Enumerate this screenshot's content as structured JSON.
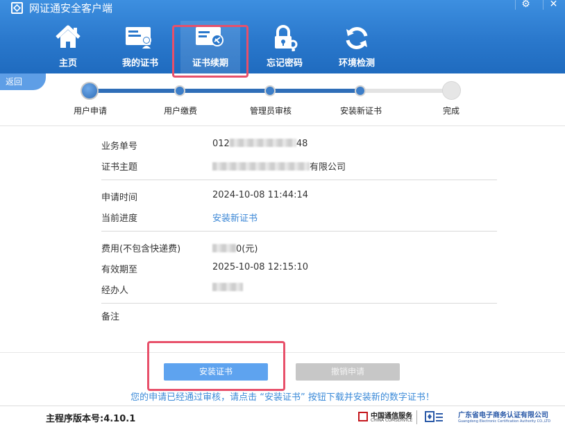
{
  "window": {
    "title": "网证通安全客户端",
    "settings_glyph": "⚙",
    "close_glyph": "✕"
  },
  "nav": {
    "items": [
      {
        "label": "主页",
        "icon": "home-icon"
      },
      {
        "label": "我的证书",
        "icon": "certificate-card-icon"
      },
      {
        "label": "证书续期",
        "icon": "certificate-renew-icon",
        "active": true
      },
      {
        "label": "忘记密码",
        "icon": "lock-key-icon"
      },
      {
        "label": "环境检测",
        "icon": "refresh-icon"
      }
    ]
  },
  "back_label": "返回",
  "steps": {
    "items": [
      "用户申请",
      "用户缴费",
      "管理员审核",
      "安装新证书",
      "完成"
    ],
    "completed_count": 4
  },
  "details": {
    "order_no": {
      "label": "业务单号",
      "prefix": "012",
      "suffix": "48"
    },
    "subject": {
      "label": "证书主题",
      "suffix": "有限公司"
    },
    "apply_time": {
      "label": "申请时间",
      "value": "2024-10-08 11:44:14"
    },
    "progress": {
      "label": "当前进度",
      "value": "安装新证书"
    },
    "fee": {
      "label": "费用(不包含快递费)",
      "suffix": "0(元)"
    },
    "valid_until": {
      "label": "有效期至",
      "value": "2025-10-08 12:15:10"
    },
    "handler": {
      "label": "经办人"
    },
    "remark": {
      "label": "备注"
    }
  },
  "buttons": {
    "install": "安装证书",
    "cancel": "撤销申请"
  },
  "notice": "您的申请已经通过审核，请点击 “安装证书” 按钮下载并安装新的数字证书！",
  "footer": {
    "version": "主程序版本号:4.10.1",
    "logo1_cn": "中国通信服务",
    "logo1_en": "CHINA COMSERVICE",
    "logo3_cn": "广东省电子商务认证有限公司",
    "logo3_en": "Guangdong Electronic Certification Authority CO.,LTD"
  },
  "colors": {
    "header": "#2a78cc",
    "accent": "#3b87d6",
    "highlight": "#e8506a",
    "step_done": "#2f6eb8"
  }
}
